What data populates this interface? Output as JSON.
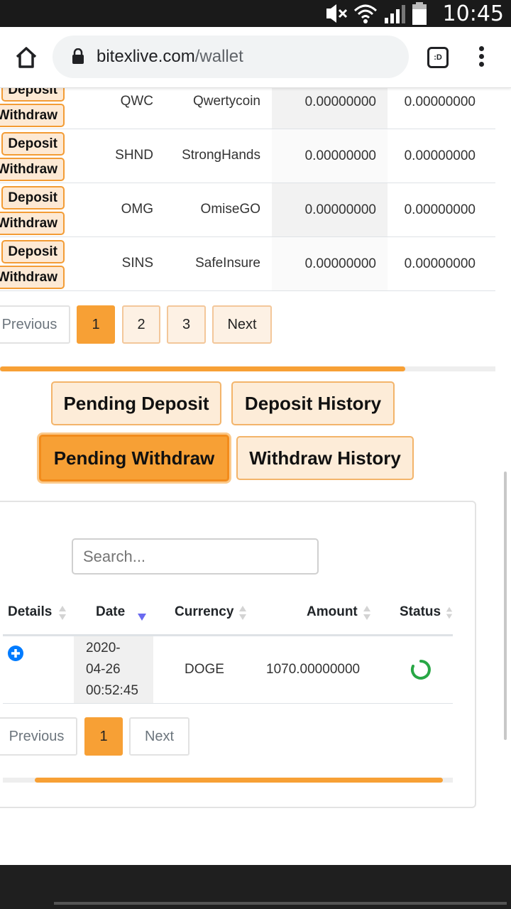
{
  "statusbar": {
    "time": "10:45"
  },
  "browser": {
    "domain": "bitexlive.com",
    "path": "/wallet",
    "tabs_label": ":D"
  },
  "wallet": {
    "deposit_label": "Deposit",
    "withdraw_label": "Withdraw",
    "rows": [
      {
        "symbol": "QWC",
        "name": "Qwertycoin",
        "balance": "0.00000000",
        "available": "0.00000000"
      },
      {
        "symbol": "SHND",
        "name": "StrongHands",
        "balance": "0.00000000",
        "available": "0.00000000"
      },
      {
        "symbol": "OMG",
        "name": "OmiseGO",
        "balance": "0.00000000",
        "available": "0.00000000"
      },
      {
        "symbol": "SINS",
        "name": "SafeInsure",
        "balance": "0.00000000",
        "available": "0.00000000"
      }
    ],
    "pagination": {
      "previous": "Previous",
      "pages": [
        "1",
        "2",
        "3"
      ],
      "next": "Next",
      "active_page": "1"
    },
    "scroll_progress": 0.81
  },
  "history_tabs": {
    "pending_deposit": "Pending Deposit",
    "deposit_history": "Deposit History",
    "pending_withdraw": "Pending Withdraw",
    "withdraw_history": "Withdraw History",
    "active": "Pending Withdraw"
  },
  "withdraw_table": {
    "search_placeholder": "Search...",
    "columns": [
      "Details",
      "Date",
      "Currency",
      "Amount",
      "Status"
    ],
    "sorted_column": "Date",
    "rows": [
      {
        "date_line1": "2020-",
        "date_line2": "04-26",
        "date_line3": "00:52:45",
        "currency": "DOGE",
        "amount": "1070.00000000",
        "status_icon": "spinner-icon"
      }
    ],
    "pagination": {
      "previous": "Previous",
      "pages": [
        "1"
      ],
      "next": "Next",
      "active_page": "1"
    },
    "scroll_progress": 0.91
  },
  "colors": {
    "accent": "#f7a035",
    "accent_light": "#fdecd8",
    "status_green": "#28a745",
    "details_blue": "#007bff"
  }
}
